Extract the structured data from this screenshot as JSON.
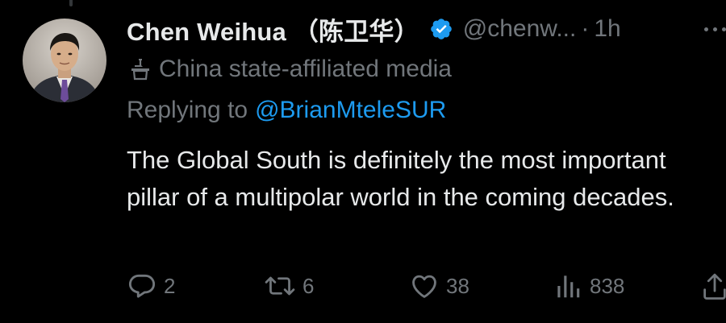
{
  "tweet": {
    "display_name": "Chen Weihua （陈卫华）",
    "handle": "@chenw...",
    "separator": "·",
    "time": "1h",
    "verified_icon": "verified-badge-icon",
    "affiliation_label": "China state-affiliated media",
    "reply_prefix": "Replying to",
    "reply_handle": "@BrianMteleSUR",
    "text": "The Global South is definitely the most important pillar of a multipolar world in the coming decades."
  },
  "actions": {
    "replies": "2",
    "retweets": "6",
    "likes": "38",
    "views": "838"
  },
  "colors": {
    "background": "#000000",
    "primary_text": "#e7e9ea",
    "secondary_text": "#71767b",
    "link": "#1d9bf0",
    "verified": "#1d9bf0"
  }
}
